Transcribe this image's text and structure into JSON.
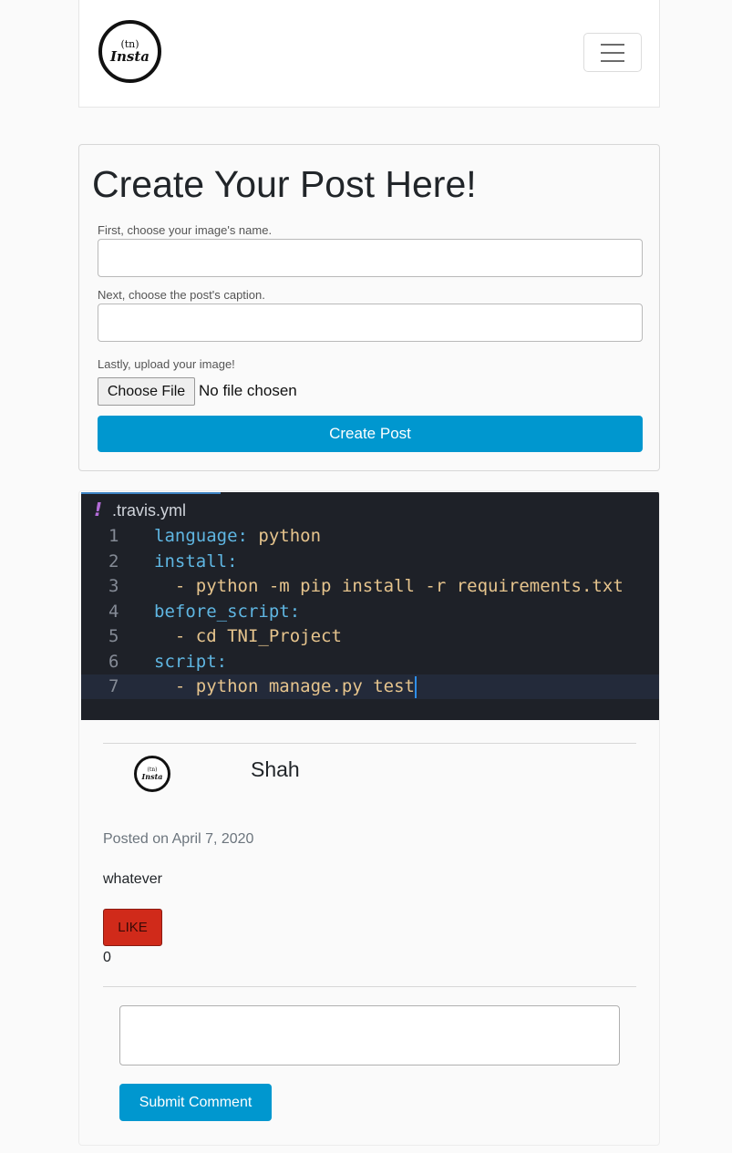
{
  "navbar": {
    "logo": {
      "small": "(tn)",
      "main": "Insta"
    }
  },
  "create_post": {
    "title": "Create Your Post Here!",
    "image_name_label": "First, choose your image's name.",
    "image_name_value": "",
    "caption_label": "Next, choose the post's caption.",
    "caption_value": "",
    "upload_label": "Lastly, upload your image!",
    "choose_file_label": "Choose File",
    "file_status": "No file chosen",
    "submit_label": "Create Post"
  },
  "post": {
    "image": {
      "tab_marker": "!",
      "tab_name": ".travis.yml",
      "lines": [
        {
          "num": "1",
          "parts": [
            {
              "t": "language:",
              "c": "kw"
            },
            {
              "t": " python",
              "c": "val"
            }
          ]
        },
        {
          "num": "2",
          "parts": [
            {
              "t": "install:",
              "c": "kw"
            }
          ]
        },
        {
          "num": "3",
          "parts": [
            {
              "t": "  - python -m pip install -r requirements.txt",
              "c": "val"
            }
          ]
        },
        {
          "num": "4",
          "parts": [
            {
              "t": "before_script:",
              "c": "kw"
            }
          ]
        },
        {
          "num": "5",
          "parts": [
            {
              "t": "  - cd TNI_Project",
              "c": "val"
            }
          ]
        },
        {
          "num": "6",
          "parts": [
            {
              "t": "script:",
              "c": "kw"
            }
          ]
        },
        {
          "num": "7",
          "parts": [
            {
              "t": "  - python manage.py test",
              "c": "val"
            }
          ]
        }
      ]
    },
    "avatar": {
      "small": "(tn)",
      "main": "Insta"
    },
    "author": "Shah",
    "posted_on": "Posted on April 7, 2020",
    "caption": "whatever",
    "like_label": "LIKE",
    "like_count": "0",
    "comment_value": "",
    "submit_comment_label": "Submit Comment"
  },
  "colors": {
    "primary": "#0097cf",
    "like": "#d02a1a",
    "code_bg": "#1e2128"
  }
}
